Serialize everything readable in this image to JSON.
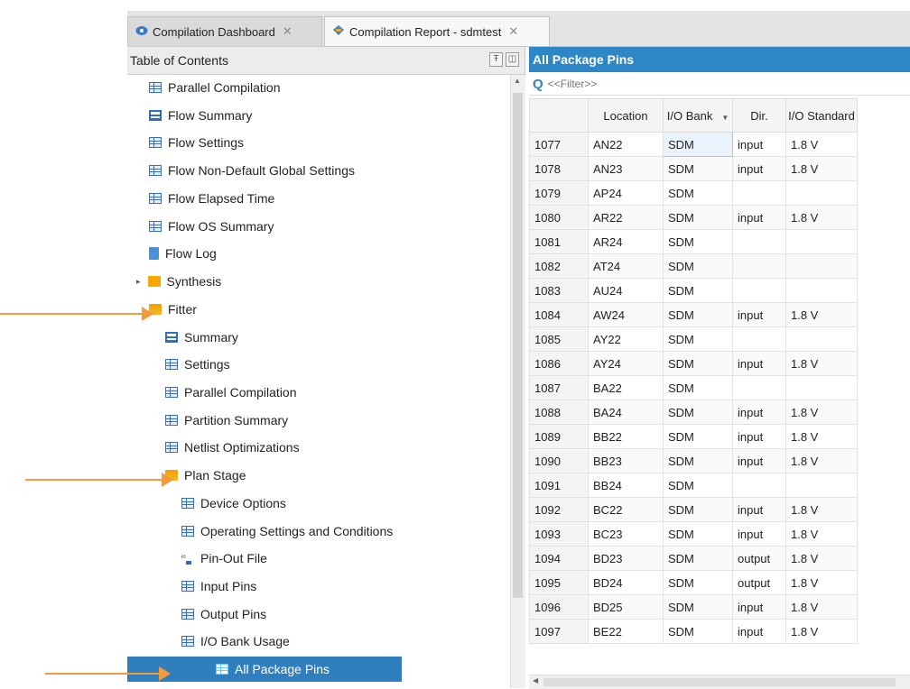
{
  "tabs": [
    {
      "label": "Compilation Dashboard",
      "icon": "dashboard-icon"
    },
    {
      "label": "Compilation Report - sdmtest",
      "icon": "report-icon"
    }
  ],
  "toc": {
    "title": "Table of Contents",
    "items": [
      {
        "label": "Parallel Compilation",
        "icon": "table-icon"
      },
      {
        "label": "Flow Summary",
        "icon": "summary-icon"
      },
      {
        "label": "Flow Settings",
        "icon": "table-icon"
      },
      {
        "label": "Flow Non-Default Global Settings",
        "icon": "table-icon"
      },
      {
        "label": "Flow Elapsed Time",
        "icon": "table-icon"
      },
      {
        "label": "Flow OS Summary",
        "icon": "table-icon"
      },
      {
        "label": "Flow Log",
        "icon": "document-icon"
      },
      {
        "label": "Synthesis",
        "icon": "folder-icon"
      },
      {
        "label": "Fitter",
        "icon": "folder-open-icon"
      },
      {
        "label": "Summary",
        "icon": "summary-icon"
      },
      {
        "label": "Settings",
        "icon": "table-icon"
      },
      {
        "label": "Parallel Compilation",
        "icon": "table-icon"
      },
      {
        "label": "Partition Summary",
        "icon": "table-icon"
      },
      {
        "label": "Netlist Optimizations",
        "icon": "table-icon"
      },
      {
        "label": "Plan Stage",
        "icon": "folder-open-icon"
      },
      {
        "label": "Device Options",
        "icon": "table-icon"
      },
      {
        "label": "Operating Settings and Conditions",
        "icon": "table-icon"
      },
      {
        "label": "Pin-Out File",
        "icon": "pin-file-icon"
      },
      {
        "label": "Input Pins",
        "icon": "table-icon"
      },
      {
        "label": "Output Pins",
        "icon": "table-icon"
      },
      {
        "label": "I/O Bank Usage",
        "icon": "table-icon"
      },
      {
        "label": "All Package Pins",
        "icon": "table-icon",
        "selected": true
      }
    ]
  },
  "report": {
    "title": "All Package Pins",
    "filter_placeholder": "<<Filter>>",
    "columns": [
      "",
      "Location",
      "I/O Bank",
      "Dir.",
      "I/O Standard"
    ],
    "rows": [
      [
        "1077",
        "AN22",
        "SDM",
        "input",
        "1.8 V"
      ],
      [
        "1078",
        "AN23",
        "SDM",
        "input",
        "1.8 V"
      ],
      [
        "1079",
        "AP24",
        "SDM",
        "",
        ""
      ],
      [
        "1080",
        "AR22",
        "SDM",
        "input",
        "1.8 V"
      ],
      [
        "1081",
        "AR24",
        "SDM",
        "",
        ""
      ],
      [
        "1082",
        "AT24",
        "SDM",
        "",
        ""
      ],
      [
        "1083",
        "AU24",
        "SDM",
        "",
        ""
      ],
      [
        "1084",
        "AW24",
        "SDM",
        "input",
        "1.8 V"
      ],
      [
        "1085",
        "AY22",
        "SDM",
        "",
        ""
      ],
      [
        "1086",
        "AY24",
        "SDM",
        "input",
        "1.8 V"
      ],
      [
        "1087",
        "BA22",
        "SDM",
        "",
        ""
      ],
      [
        "1088",
        "BA24",
        "SDM",
        "input",
        "1.8 V"
      ],
      [
        "1089",
        "BB22",
        "SDM",
        "input",
        "1.8 V"
      ],
      [
        "1090",
        "BB23",
        "SDM",
        "input",
        "1.8 V"
      ],
      [
        "1091",
        "BB24",
        "SDM",
        "",
        ""
      ],
      [
        "1092",
        "BC22",
        "SDM",
        "input",
        "1.8 V"
      ],
      [
        "1093",
        "BC23",
        "SDM",
        "input",
        "1.8 V"
      ],
      [
        "1094",
        "BD23",
        "SDM",
        "output",
        "1.8 V"
      ],
      [
        "1095",
        "BD24",
        "SDM",
        "output",
        "1.8 V"
      ],
      [
        "1096",
        "BD25",
        "SDM",
        "input",
        "1.8 V"
      ],
      [
        "1097",
        "BE22",
        "SDM",
        "input",
        "1.8 V"
      ]
    ]
  },
  "colors": {
    "accent": "#2d86c5",
    "selection": "#2f7fbf",
    "annotation": "#f39a3a",
    "folder": "#f6a800"
  }
}
